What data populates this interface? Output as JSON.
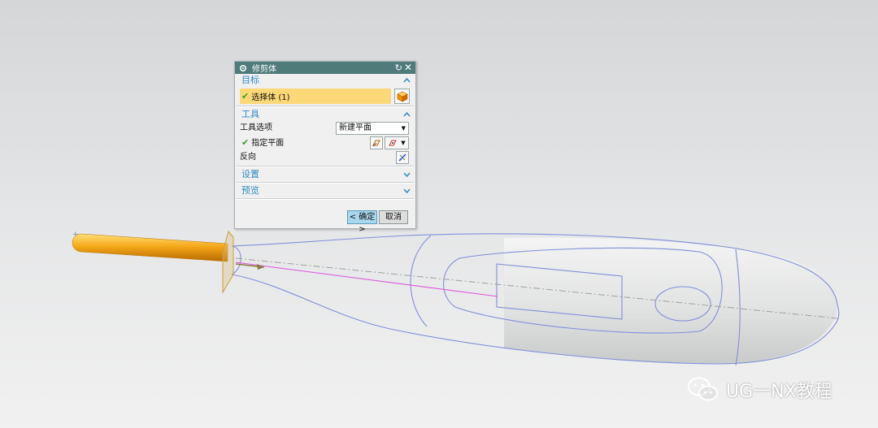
{
  "dialog": {
    "title": "修剪体",
    "groups": {
      "target": {
        "label": "目标",
        "select_body_label": "选择体 (1)"
      },
      "tool": {
        "label": "工具",
        "tool_option_label": "工具选项",
        "tool_option_value": "新建平面",
        "specify_plane_label": "指定平面",
        "reverse_label": "反向"
      },
      "settings": {
        "label": "设置"
      },
      "preview": {
        "label": "预览"
      }
    },
    "buttons": {
      "ok": "< 确定 >",
      "cancel": "取消"
    }
  },
  "watermark": {
    "text": "UG一NX教程"
  },
  "colors": {
    "title_bar": "#4f7b7b",
    "group_header_text": "#2f8ac7",
    "selection_highlight": "#fcd878",
    "curve_lines": "#8090d8",
    "handle_body": "#f0a010",
    "plane_edge": "#c8a040"
  },
  "icons": {
    "dialog": "gear-icon",
    "reset": "reset-icon",
    "close": "close-icon",
    "select_body": "cube-icon",
    "plane_dialog": "plane-dialog-icon",
    "plane_infer": "plane-infer-icon",
    "reverse": "reverse-direction-icon",
    "wechat": "wechat-icon"
  }
}
